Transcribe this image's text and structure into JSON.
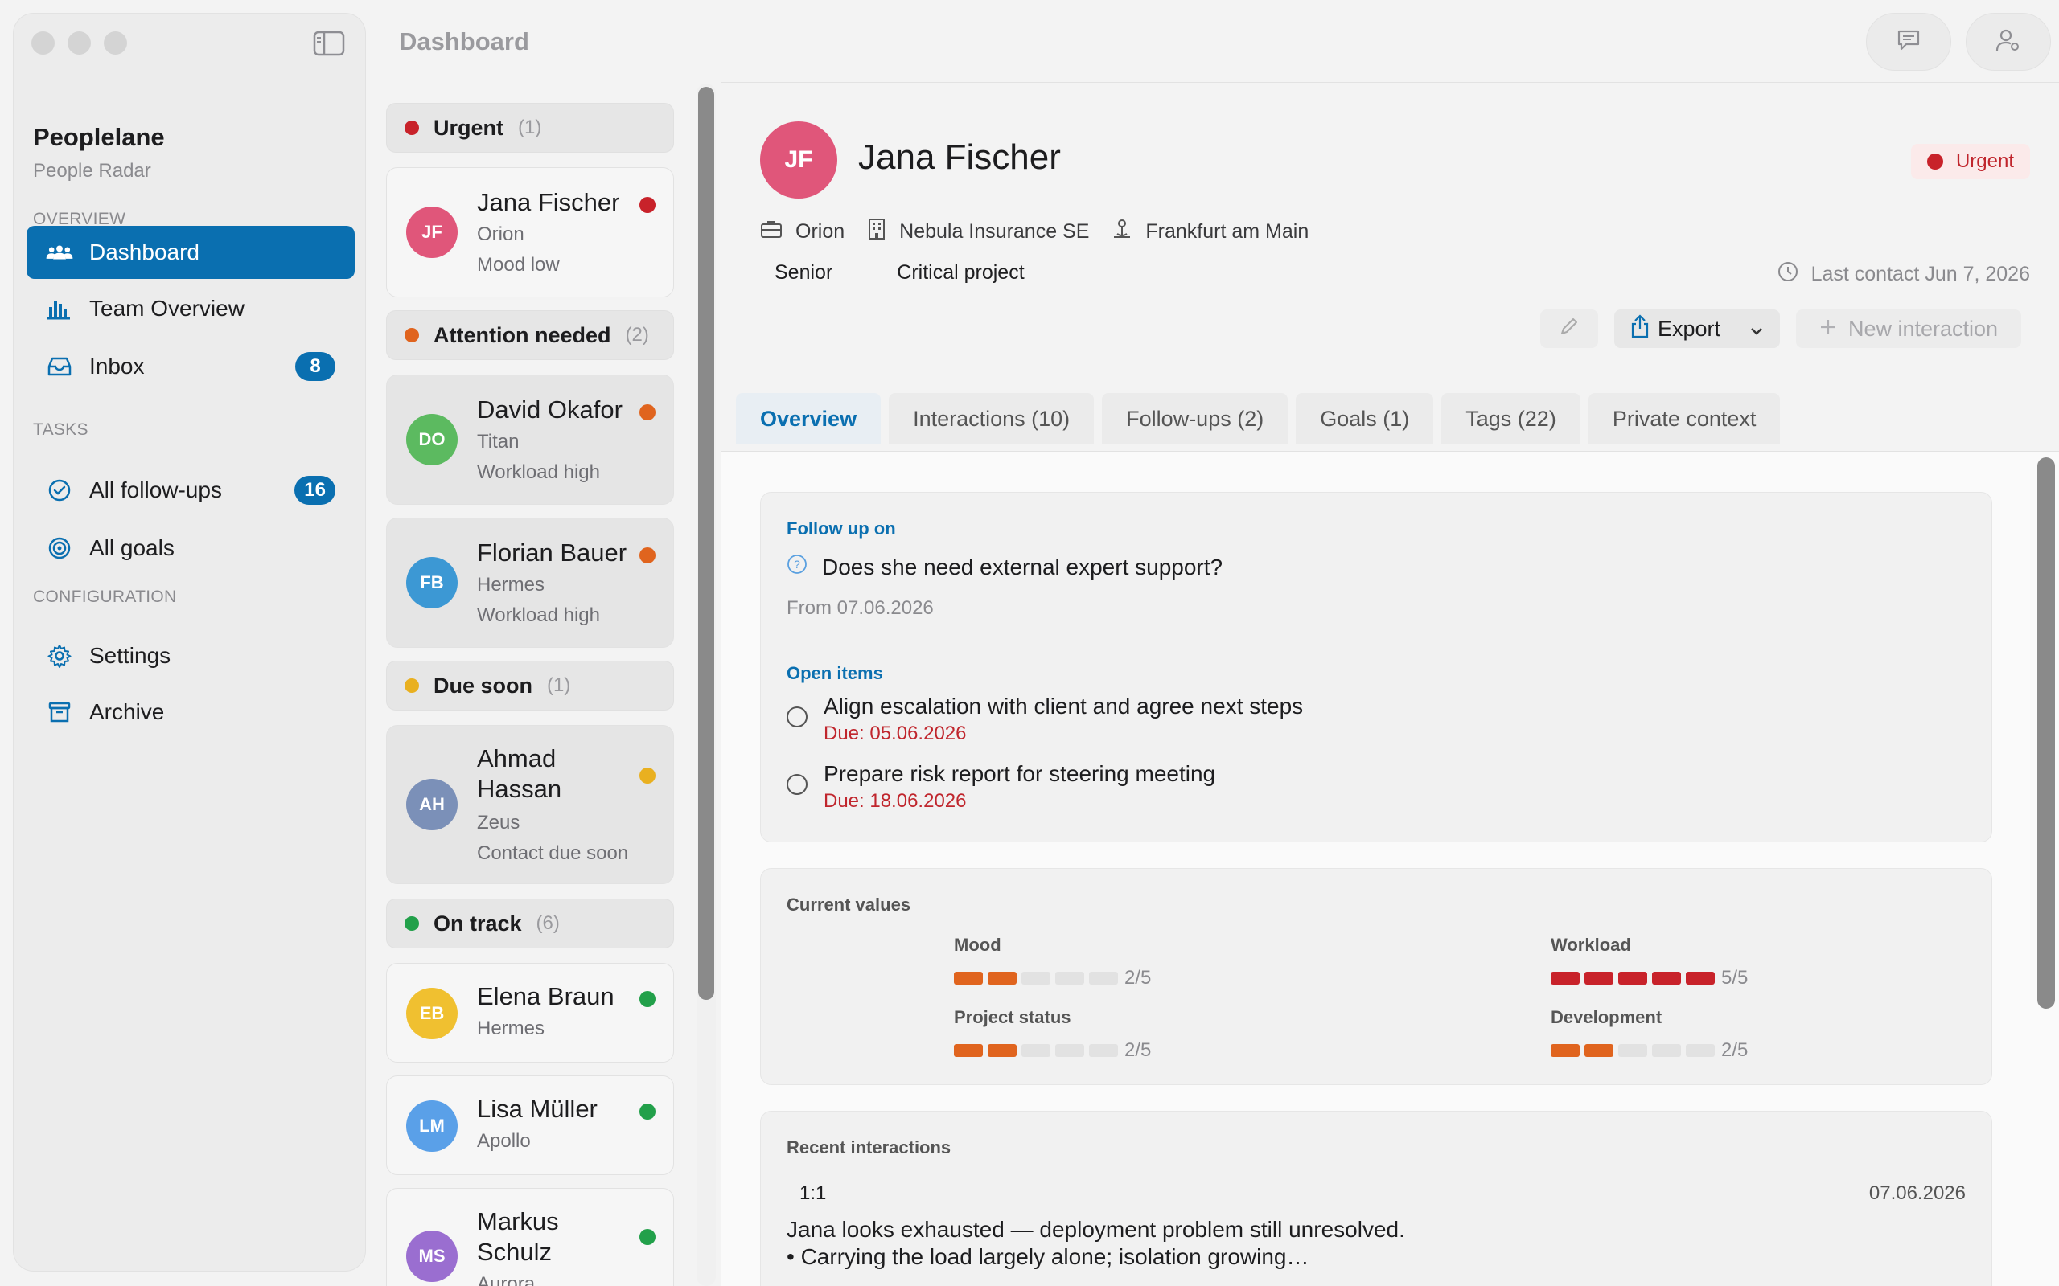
{
  "app": {
    "title": "Peoplelane",
    "subtitle": "People Radar"
  },
  "topbar": {
    "title": "Dashboard"
  },
  "sidebar": {
    "overview_label": "OVERVIEW",
    "tasks_label": "TASKS",
    "config_label": "CONFIGURATION",
    "items": [
      {
        "label": "Dashboard"
      },
      {
        "label": "Team Overview"
      },
      {
        "label": "Inbox",
        "badge": "8"
      },
      {
        "label": "All follow-ups",
        "badge": "16"
      },
      {
        "label": "All goals"
      },
      {
        "label": "Settings"
      },
      {
        "label": "Archive"
      }
    ]
  },
  "groups": [
    {
      "label": "Urgent",
      "count": "(1)",
      "color": "#c8222a"
    },
    {
      "label": "Attention needed",
      "count": "(2)",
      "color": "#e0641e"
    },
    {
      "label": "Due soon",
      "count": "(1)",
      "color": "#e9b020"
    },
    {
      "label": "On track",
      "count": "(6)",
      "color": "#22a04a"
    }
  ],
  "people": [
    {
      "initials": "JF",
      "name": "Jana Fischer",
      "team": "Orion",
      "note": "Mood low",
      "color": "#e0567a",
      "status": "#c8222a"
    },
    {
      "initials": "DO",
      "name": "David Okafor",
      "team": "Titan",
      "note": "Workload high",
      "color": "#5cba60",
      "status": "#e0641e"
    },
    {
      "initials": "FB",
      "name": "Florian Bauer",
      "team": "Hermes",
      "note": "Workload high",
      "color": "#3c98d4",
      "status": "#e0641e"
    },
    {
      "initials": "AH",
      "name_1": "Ahmad",
      "name_2": "Hassan",
      "team": "Zeus",
      "note": "Contact due soon",
      "color": "#7b90b8",
      "status": "#e9b020"
    },
    {
      "initials": "EB",
      "name": "Elena Braun",
      "team": "Hermes",
      "color": "#f0c030",
      "status": "#22a04a"
    },
    {
      "initials": "LM",
      "name": "Lisa Müller",
      "team": "Apollo",
      "color": "#5aa0e8",
      "status": "#22a04a"
    },
    {
      "initials": "MS",
      "name_1": "Markus",
      "name_2": "Schulz",
      "team": "Aurora",
      "color": "#9a6ed0",
      "status": "#22a04a"
    }
  ],
  "detail": {
    "initials": "JF",
    "name": "Jana Fischer",
    "urgent_label": "Urgent",
    "team": "Orion",
    "company": "Nebula Insurance SE",
    "location": "Frankfurt am Main",
    "tag_1": "Senior",
    "tag_2": "Critical project",
    "last_contact": "Last contact Jun 7, 2026",
    "export_label": "Export",
    "new_interaction_label": "New interaction",
    "tabs": [
      {
        "label": "Overview"
      },
      {
        "label": "Interactions (10)"
      },
      {
        "label": "Follow-ups (2)"
      },
      {
        "label": "Goals (1)"
      },
      {
        "label": "Tags (22)"
      },
      {
        "label": "Private context"
      }
    ],
    "followup": {
      "label": "Follow up on",
      "question": "Does she need external expert support?",
      "from": "From 07.06.2026",
      "open_label": "Open items",
      "items": [
        {
          "title": "Align escalation with client and agree next steps",
          "due": "Due: 05.06.2026"
        },
        {
          "title": "Prepare risk report for steering meeting",
          "due": "Due: 18.06.2026"
        }
      ]
    },
    "values": {
      "label": "Current values",
      "metrics": [
        {
          "name": "Mood",
          "value": 2,
          "max": 5,
          "display": "2/5",
          "color": "#e0641e"
        },
        {
          "name": "Workload",
          "value": 5,
          "max": 5,
          "display": "5/5",
          "color": "#c8222a"
        },
        {
          "name": "Project status",
          "value": 2,
          "max": 5,
          "display": "2/5",
          "color": "#e0641e"
        },
        {
          "name": "Development",
          "value": 2,
          "max": 5,
          "display": "2/5",
          "color": "#e0641e"
        }
      ]
    },
    "recent": {
      "label": "Recent interactions",
      "type": "1:1",
      "date": "07.06.2026",
      "line_1": "Jana looks exhausted — deployment problem still unresolved.",
      "line_2": "• Carrying the load largely alone; isolation growing…"
    }
  },
  "colors": {
    "accent": "#0a6fb0",
    "urgent": "#c8222a",
    "attention": "#e0641e",
    "due": "#e9b020",
    "ok": "#22a04a"
  }
}
